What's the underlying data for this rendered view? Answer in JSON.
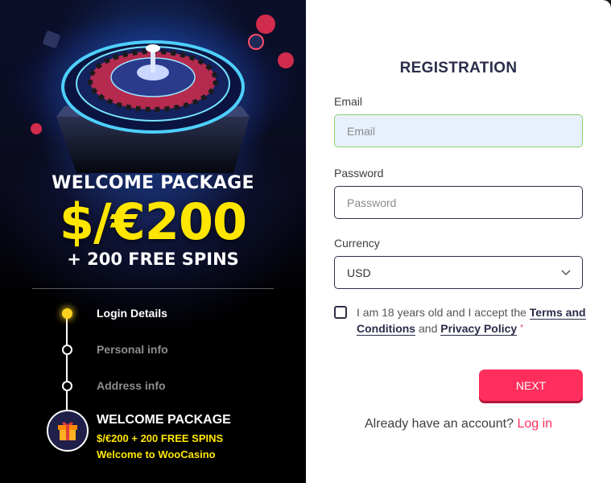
{
  "promo": {
    "title": "WELCOME PACKAGE",
    "amount": "$/€200",
    "spins": "+ 200 FREE SPINS"
  },
  "steps": [
    {
      "label": "Login Details",
      "active": true
    },
    {
      "label": "Personal info",
      "active": false
    },
    {
      "label": "Address info",
      "active": false
    }
  ],
  "bonus": {
    "title": "WELCOME PACKAGE",
    "line1": "$/€200 + 200 FREE SPINS",
    "line2": "Welcome to WooCasino",
    "icon": "gift-icon"
  },
  "form": {
    "title": "REGISTRATION",
    "email_label": "Email",
    "email_placeholder": "Email",
    "password_label": "Password",
    "password_placeholder": "Password",
    "currency_label": "Currency",
    "currency_value": "USD",
    "terms_prefix": "I am 18 years old and I accept the",
    "terms_link": "Terms and Conditions",
    "terms_and": "and",
    "privacy_link": "Privacy Policy",
    "required_mark": "*",
    "next_label": "NEXT",
    "login_prompt": "Already have an account?",
    "login_link": "Log in"
  },
  "colors": {
    "accent": "#ff2e5c",
    "promo_yellow": "#ffe600",
    "navy": "#2b2d4a",
    "email_bg": "#e8f0fe",
    "email_border": "#8ad36d"
  }
}
